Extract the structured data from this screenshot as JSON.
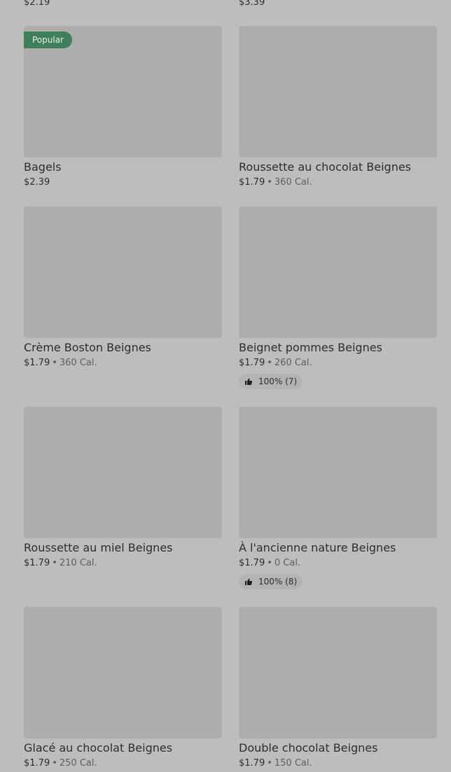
{
  "top_prices": [
    "$2.19",
    "$3.39"
  ],
  "items": [
    {
      "title": "Bagels",
      "price": "$2.39",
      "calories": "",
      "badge": "Popular",
      "rating": ""
    },
    {
      "title": "Roussette au chocolat Beignes",
      "price": "$1.79",
      "calories": "360 Cal.",
      "badge": "",
      "rating": ""
    },
    {
      "title": "Crème Boston Beignes",
      "price": "$1.79",
      "calories": "360 Cal.",
      "badge": "",
      "rating": ""
    },
    {
      "title": "Beignet pommes Beignes",
      "price": "$1.79",
      "calories": "260 Cal.",
      "badge": "",
      "rating": "100% (7)"
    },
    {
      "title": "Roussette au miel Beignes",
      "price": "$1.79",
      "calories": "210 Cal.",
      "badge": "",
      "rating": ""
    },
    {
      "title": "À l'ancienne nature Beignes",
      "price": "$1.79",
      "calories": "0 Cal.",
      "badge": "",
      "rating": "100% (8)"
    },
    {
      "title": "Glacé au chocolat Beignes",
      "price": "$1.79",
      "calories": "250 Cal.",
      "badge": "",
      "rating": ""
    },
    {
      "title": "Double chocolat Beignes",
      "price": "$1.79",
      "calories": "150 Cal.",
      "badge": "",
      "rating": ""
    }
  ],
  "separator": "•",
  "icons": {
    "rating": "thumbs-up-icon"
  },
  "colors": {
    "badge": "#3f7f5c",
    "background": "#bdbdbd",
    "thumbnail": "#adadad"
  }
}
